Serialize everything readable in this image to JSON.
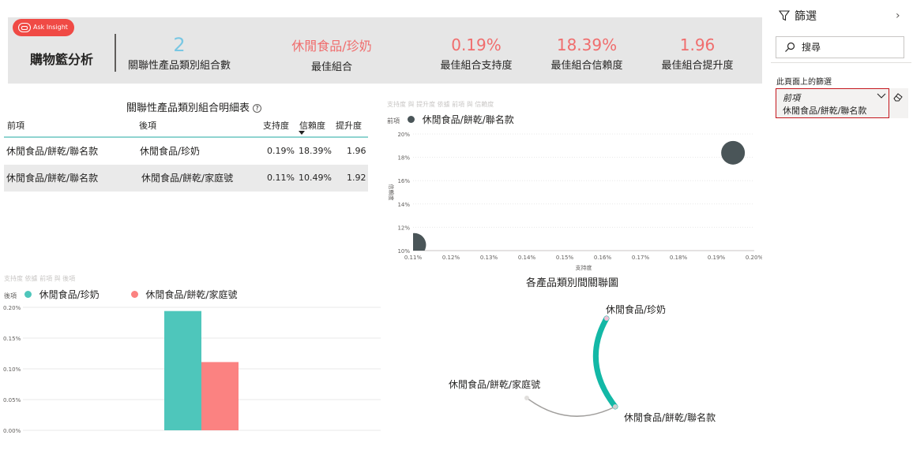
{
  "ask_insight": {
    "label": "Ask Insight"
  },
  "kpis": {
    "title": "購物籃分析",
    "items": [
      {
        "value": "2",
        "label": "關聯性產品類別組合數",
        "color": "#79c7e3"
      },
      {
        "value": "休閒食品/珍奶",
        "label": "最佳組合",
        "color": "#f06d6d"
      },
      {
        "value": "0.19%",
        "label": "最佳組合支持度",
        "color": "#f06d6d"
      },
      {
        "value": "18.39%",
        "label": "最佳組合信賴度",
        "color": "#f06d6d"
      },
      {
        "value": "1.96",
        "label": "最佳組合提升度",
        "color": "#f06d6d"
      }
    ]
  },
  "table": {
    "title": "關聯性產品類別組合明細表",
    "columns": [
      "前項",
      "後項",
      "支持度",
      "信賴度",
      "提升度"
    ],
    "rows": [
      [
        "休閒食品/餅乾/聯名款",
        "休閒食品/珍奶",
        "0.19%",
        "18.39%",
        "1.96"
      ],
      [
        "休閒食品/餅乾/聯名款",
        "休閒食品/餅乾/家庭號",
        "0.11%",
        "10.49%",
        "1.92"
      ]
    ]
  },
  "scatter": {
    "faded_title": "支持度 與 提升度 依據 前項 與 信賴度",
    "legend_caption": "前項",
    "legend_item": "休閒食品/餅乾/聯名款",
    "legend_color": "#4a5558"
  },
  "barchart": {
    "faded_title": "支持度 依據 前項 與 後項",
    "legend_caption": "後項",
    "legend_items": [
      {
        "name": "休閒食品/珍奶",
        "color": "#4ec6bb"
      },
      {
        "name": "休閒食品/餅乾/家庭號",
        "color": "#fb8281"
      }
    ]
  },
  "network": {
    "title": "各產品類別間關聯圖",
    "nodes": [
      "休閒食品/珍奶",
      "休閒食品/餅乾/家庭號",
      "休閒食品/餅乾/聯名款"
    ],
    "edge_color_strong": "#13b8a6",
    "edge_color_weak": "#a19f9d"
  },
  "chart_data": [
    {
      "type": "scatter",
      "xlabel": "支持度",
      "ylabel": "信賴度",
      "x_ticks": [
        "0.11%",
        "0.12%",
        "0.13%",
        "0.14%",
        "0.15%",
        "0.16%",
        "0.17%",
        "0.18%",
        "0.19%",
        "0.20%"
      ],
      "y_ticks": [
        "10%",
        "12%",
        "14%",
        "16%",
        "18%",
        "20%"
      ],
      "xlim": [
        0.11,
        0.2
      ],
      "ylim": [
        10,
        20
      ],
      "series": [
        {
          "name": "休閒食品/餅乾/聯名款",
          "points": [
            {
              "x": 0.1944,
              "y": 18.39
            },
            {
              "x": 0.1103,
              "y": 10.49
            }
          ]
        }
      ]
    },
    {
      "type": "bar",
      "categories": [
        ""
      ],
      "y_ticks": [
        "0.00%",
        "0.05%",
        "0.10%",
        "0.15%",
        "0.20%"
      ],
      "ylim": [
        0,
        0.2
      ],
      "series": [
        {
          "name": "休閒食品/珍奶",
          "values": [
            0.194
          ]
        },
        {
          "name": "休閒食品/餅乾/家庭號",
          "values": [
            0.111
          ]
        }
      ]
    }
  ],
  "filter_pane": {
    "title": "篩選",
    "search_placeholder": "搜尋",
    "section_label": "此頁面上的篩選",
    "filter_name": "前項",
    "filter_value": "休閒食品/餅乾/聯名款"
  }
}
